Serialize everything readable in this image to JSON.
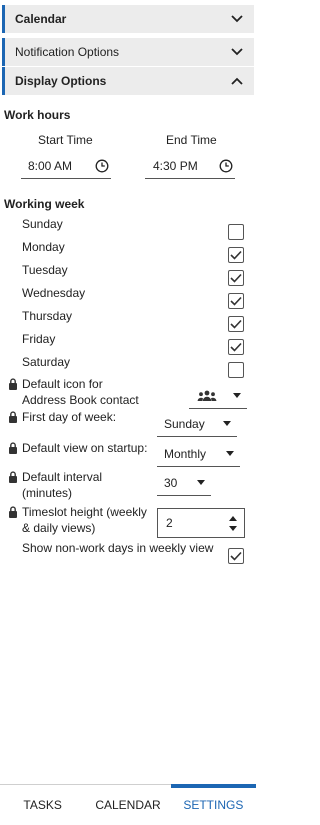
{
  "sections": {
    "calendar": "Calendar",
    "notification": "Notification Options",
    "display": "Display Options"
  },
  "work_hours": {
    "title": "Work hours",
    "start_label": "Start Time",
    "end_label": "End Time",
    "start_value": "8:00 AM",
    "end_value": "4:30 PM"
  },
  "working_week": {
    "title": "Working week",
    "days": [
      {
        "label": "Sunday",
        "checked": false
      },
      {
        "label": "Monday",
        "checked": true
      },
      {
        "label": "Tuesday",
        "checked": true
      },
      {
        "label": "Wednesday",
        "checked": true
      },
      {
        "label": "Thursday",
        "checked": true
      },
      {
        "label": "Friday",
        "checked": true
      },
      {
        "label": "Saturday",
        "checked": false
      }
    ]
  },
  "options": {
    "default_icon_label": "Default icon for Address Book contact",
    "first_day_label": "First day of week:",
    "first_day_value": "Sunday",
    "default_view_label": "Default view on startup:",
    "default_view_value": "Monthly",
    "default_interval_label": "Default interval (minutes)",
    "default_interval_value": "30",
    "timeslot_label": "Timeslot height (weekly & daily views)",
    "timeslot_value": "2",
    "show_nonwork_label": "Show non-work days in weekly view",
    "show_nonwork_checked": true
  },
  "tabs": {
    "tasks": "TASKS",
    "calendar": "CALENDAR",
    "settings": "SETTINGS"
  },
  "colors": {
    "accent": "#1c66b3",
    "header_bg": "#ececec"
  }
}
